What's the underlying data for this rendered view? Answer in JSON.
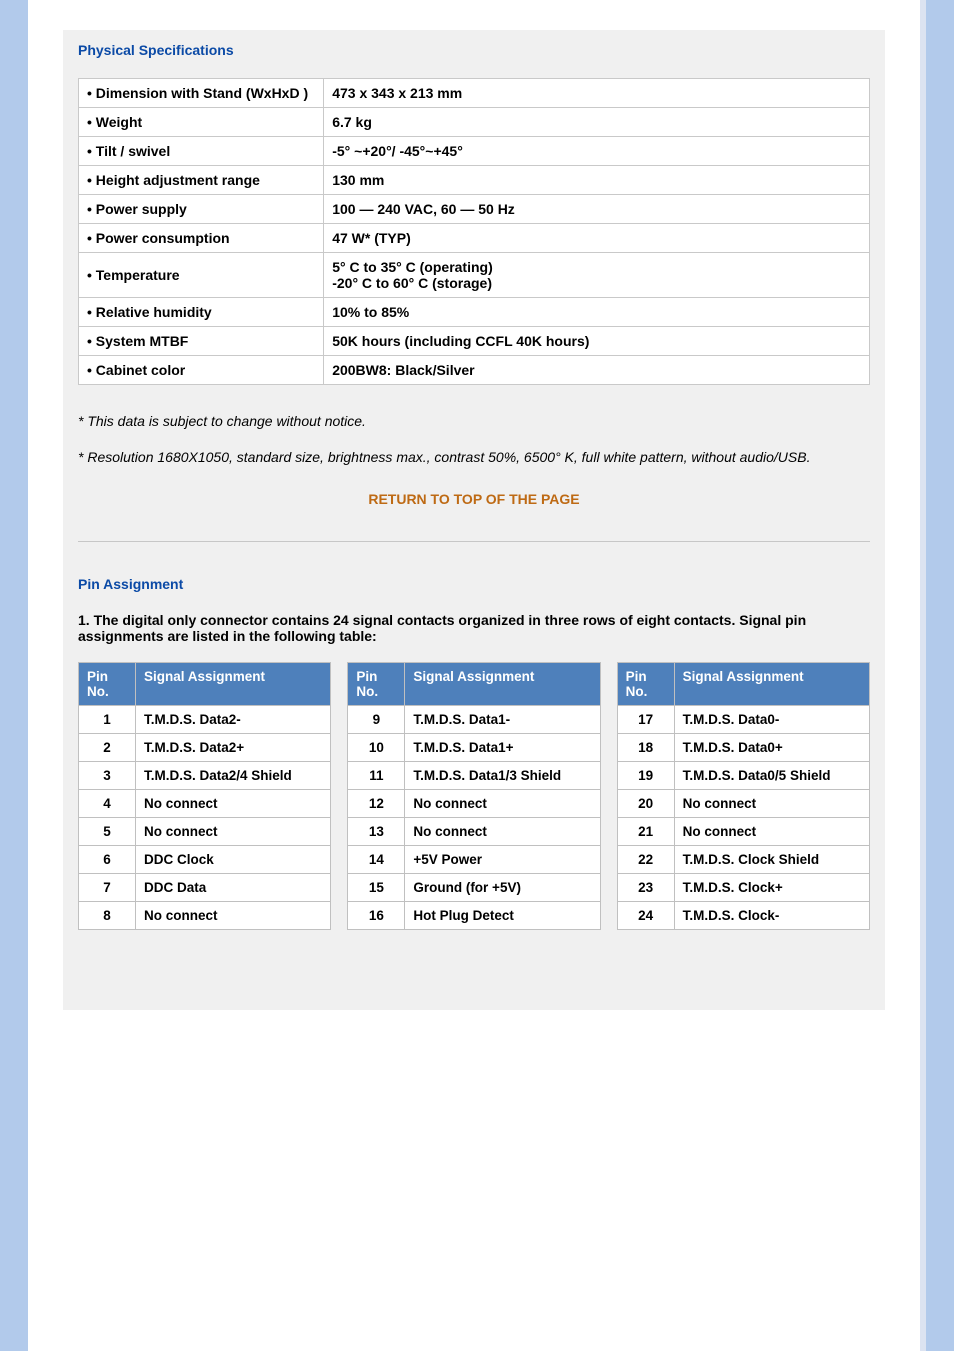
{
  "headings": {
    "physical": "Physical Specifications",
    "pin": "Pin Assignment"
  },
  "spec_rows": [
    {
      "label": "• Dimension with Stand (WxHxD )",
      "value": "473 x 343 x 213 mm"
    },
    {
      "label": "• Weight",
      "value": "6.7 kg"
    },
    {
      "label": "• Tilt / swivel",
      "value": "-5° ~+20°/ -45°~+45°"
    },
    {
      "label": "• Height adjustment range",
      "value": " 130 mm"
    },
    {
      "label": "• Power supply",
      "value": "100 — 240 VAC, 60 — 50 Hz"
    },
    {
      "label": "• Power consumption",
      "value": "47 W* (TYP)"
    },
    {
      "label": "• Temperature",
      "value": "5° C to 35° C (operating)\n-20° C to 60° C (storage)"
    },
    {
      "label": "• Relative humidity",
      "value": "10% to 85%"
    },
    {
      "label": "• System MTBF",
      "value": "50K hours (including CCFL 40K hours)"
    },
    {
      "label": "• Cabinet color",
      "value": "200BW8: Black/Silver"
    }
  ],
  "notes": {
    "n1": "* This data is subject to change without notice.",
    "n2": "* Resolution 1680X1050, standard size, brightness max., contrast 50%, 6500° K, full white pattern, without audio/USB."
  },
  "return_link": "RETURN TO TOP OF THE PAGE",
  "pin_intro": "1. The digital only connector contains 24 signal contacts organized in three rows of eight contacts. Signal pin assignments are listed in the following table:",
  "pin_header": {
    "no": "Pin\nNo.",
    "sig": "Signal\nAssignment"
  },
  "pin_cols": [
    [
      {
        "no": "1",
        "sig": "T.M.D.S. Data2-"
      },
      {
        "no": "2",
        "sig": "T.M.D.S. Data2+"
      },
      {
        "no": "3",
        "sig": "T.M.D.S. Data2/4 Shield"
      },
      {
        "no": "4",
        "sig": "No connect"
      },
      {
        "no": "5",
        "sig": "No connect"
      },
      {
        "no": "6",
        "sig": "DDC Clock"
      },
      {
        "no": "7",
        "sig": "DDC Data"
      },
      {
        "no": "8",
        "sig": "No connect"
      }
    ],
    [
      {
        "no": "9",
        "sig": "T.M.D.S. Data1-"
      },
      {
        "no": "10",
        "sig": "T.M.D.S. Data1+"
      },
      {
        "no": "11",
        "sig": "T.M.D.S. Data1/3 Shield"
      },
      {
        "no": "12",
        "sig": "No connect"
      },
      {
        "no": "13",
        "sig": "No connect"
      },
      {
        "no": "14",
        "sig": "+5V Power"
      },
      {
        "no": "15",
        "sig": "Ground (for +5V)"
      },
      {
        "no": "16",
        "sig": "Hot Plug Detect"
      }
    ],
    [
      {
        "no": "17",
        "sig": "T.M.D.S. Data0-"
      },
      {
        "no": "18",
        "sig": "T.M.D.S. Data0+"
      },
      {
        "no": "19",
        "sig": "T.M.D.S. Data0/5 Shield"
      },
      {
        "no": "20",
        "sig": "No connect"
      },
      {
        "no": "21",
        "sig": "No connect"
      },
      {
        "no": "22",
        "sig": "T.M.D.S. Clock Shield"
      },
      {
        "no": "23",
        "sig": "T.M.D.S. Clock+"
      },
      {
        "no": "24",
        "sig": "T.M.D.S. Clock-"
      }
    ]
  ]
}
